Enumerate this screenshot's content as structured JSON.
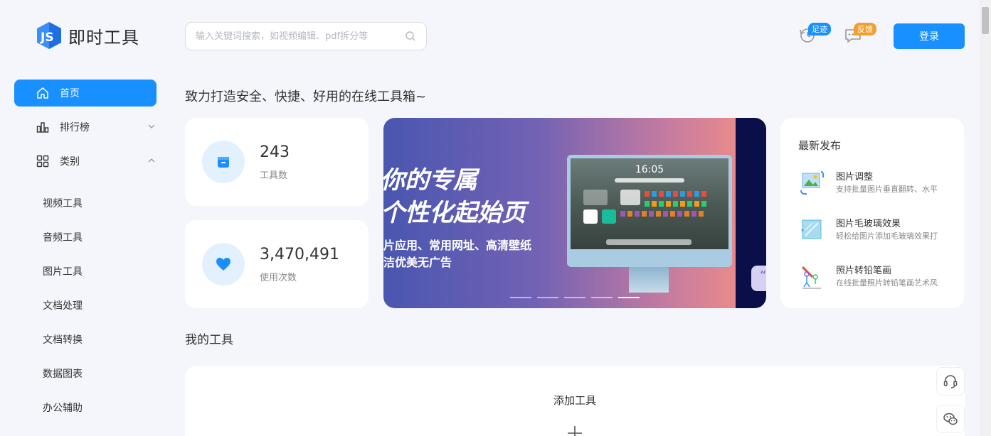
{
  "header": {
    "logo_text": "即时工具",
    "search_placeholder": "输入关键词搜索，如视频编辑、pdf拆分等",
    "history_badge": "足迹",
    "feedback_badge": "反馈",
    "login_label": "登录",
    "colors": {
      "accent": "#1890ff",
      "feedback_badge": "#f0a030"
    }
  },
  "sidebar": {
    "items": [
      {
        "label": "首页",
        "icon": "home-icon",
        "active": true
      },
      {
        "label": "排行榜",
        "icon": "bar-chart-icon"
      },
      {
        "label": "类别",
        "icon": "grid-icon"
      }
    ],
    "categories": [
      "视频工具",
      "音频工具",
      "图片工具",
      "文档处理",
      "文档转换",
      "数据图表",
      "办公辅助"
    ]
  },
  "main": {
    "tagline": "致力打造安全、快捷、好用的在线工具箱~",
    "stats": [
      {
        "value": "243",
        "label": "工具数",
        "icon": "box-icon"
      },
      {
        "value": "3,470,491",
        "label": "使用次数",
        "icon": "heart-icon"
      }
    ],
    "banner": {
      "line1": "你的专属",
      "line2": "个性化起始页",
      "line3": "片应用、常用网址、高清壁纸",
      "line4": "洁优美无广告",
      "screen_time": "16:05",
      "quote_mark": "“"
    },
    "latest": {
      "title": "最新发布",
      "items": [
        {
          "name": "图片调整",
          "desc": "支持批量图片垂直翻转、水平",
          "icon": "image-rotate-icon"
        },
        {
          "name": "图片毛玻璃效果",
          "desc": "轻松给图片添加毛玻璃效果打",
          "icon": "frosted-glass-icon"
        },
        {
          "name": "照片转铅笔画",
          "desc": "在线批量照片转铅笔画艺术风",
          "icon": "pencil-sketch-icon"
        }
      ]
    },
    "my_tools": {
      "title": "我的工具",
      "add_label": "添加工具"
    }
  }
}
